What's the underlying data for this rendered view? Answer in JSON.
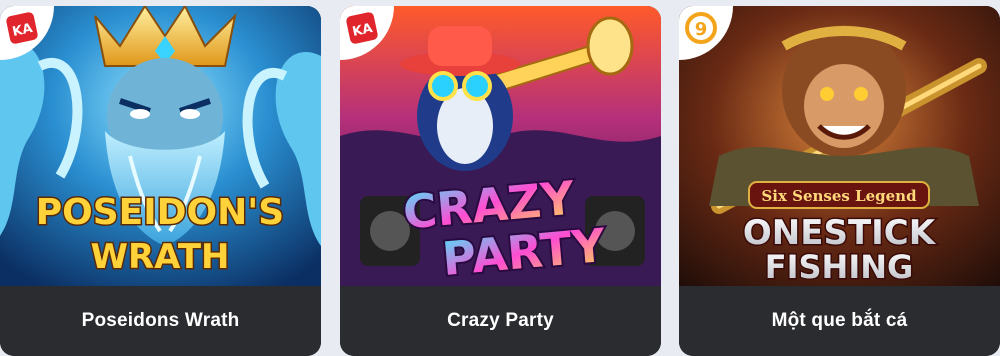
{
  "games": [
    {
      "title": "Poseidons Wrath",
      "provider_icon": "ka-dice-icon",
      "provider_text": "KA",
      "art_title_line1": "POSEIDON'S",
      "art_title_line2": "WRATH"
    },
    {
      "title": "Crazy Party",
      "provider_icon": "ka-dice-icon",
      "provider_text": "KA",
      "art_title_line1": "CRAZY",
      "art_title_line2": "PARTY"
    },
    {
      "title": "Một que bắt cá",
      "provider_icon": "provider-9-icon",
      "provider_text": "9",
      "art_subtitle": "Six Senses Legend",
      "art_title_line1": "ONESTICK",
      "art_title_line2": "FISHING"
    }
  ],
  "colors": {
    "caption_bg": "#2b2c30",
    "page_bg": "#e9ebf3",
    "badge_red": "#e0262c",
    "badge_orange": "#f3a41b"
  }
}
